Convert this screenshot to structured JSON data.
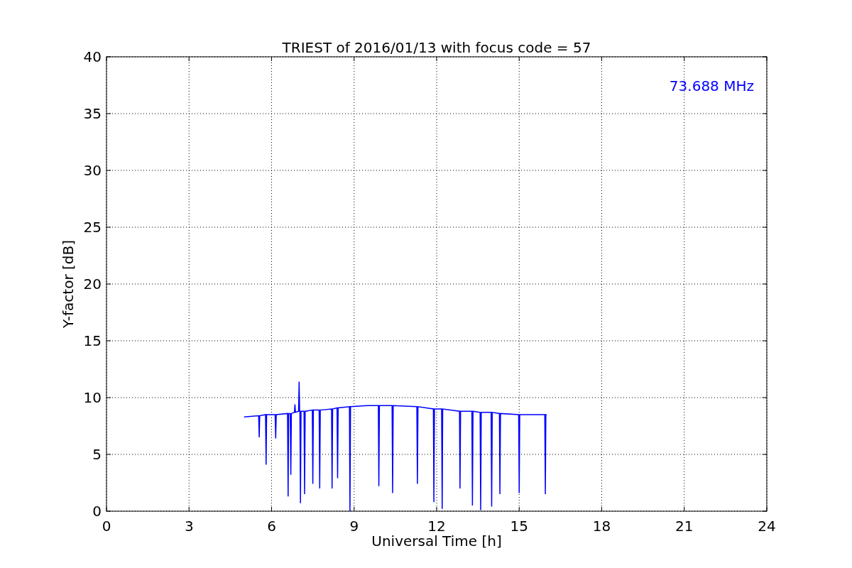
{
  "chart_data": {
    "type": "line",
    "title": "TRIEST of 2016/01/13 with focus code = 57",
    "xlabel": "Universal Time [h]",
    "ylabel": "Y-factor [dB]",
    "xlim": [
      0,
      24
    ],
    "ylim": [
      0,
      40
    ],
    "grid": true,
    "xticks": [
      0,
      3,
      6,
      9,
      12,
      15,
      18,
      21,
      24
    ],
    "yticks": [
      0,
      5,
      10,
      15,
      20,
      25,
      30,
      35,
      40
    ],
    "series": [
      {
        "name": "73.688 MHz",
        "color": "#0000ff",
        "x": [
          5.0,
          5.53,
          5.55,
          5.57,
          5.78,
          5.8,
          5.82,
          6.13,
          6.15,
          6.17,
          6.58,
          6.6,
          6.62,
          6.68,
          6.7,
          6.72,
          6.83,
          6.85,
          6.87,
          6.98,
          7.0,
          7.02,
          7.03,
          7.05,
          7.07,
          7.18,
          7.2,
          7.22,
          7.48,
          7.5,
          7.52,
          7.73,
          7.75,
          7.77,
          8.18,
          8.2,
          8.22,
          8.38,
          8.4,
          8.42,
          8.83,
          8.85,
          8.87,
          9.5,
          9.88,
          9.9,
          9.92,
          10.38,
          10.4,
          10.42,
          11.28,
          11.3,
          11.32,
          11.88,
          11.9,
          11.92,
          12.18,
          12.2,
          12.22,
          12.83,
          12.85,
          12.87,
          13.28,
          13.3,
          13.32,
          13.58,
          13.6,
          13.62,
          13.98,
          14.0,
          14.02,
          14.28,
          14.3,
          14.32,
          14.98,
          15.0,
          15.02,
          15.93,
          15.95,
          15.97,
          16.0
        ],
        "values": [
          8.3,
          8.4,
          6.5,
          8.4,
          8.5,
          4.1,
          8.5,
          8.5,
          6.4,
          8.5,
          8.6,
          1.3,
          8.6,
          8.6,
          3.2,
          8.6,
          8.7,
          9.4,
          8.7,
          8.8,
          11.4,
          8.8,
          8.8,
          0.7,
          8.8,
          8.8,
          1.5,
          8.8,
          8.9,
          2.4,
          8.9,
          8.9,
          2.0,
          8.9,
          9.0,
          2.0,
          9.0,
          9.1,
          2.9,
          9.1,
          9.2,
          0.0,
          9.2,
          9.3,
          9.3,
          2.2,
          9.3,
          9.3,
          1.6,
          9.3,
          9.2,
          2.4,
          9.2,
          9.0,
          0.8,
          9.0,
          9.0,
          0.2,
          9.0,
          8.8,
          2.0,
          8.8,
          8.8,
          0.5,
          8.8,
          8.7,
          0.1,
          8.7,
          8.7,
          0.4,
          8.7,
          8.6,
          1.5,
          8.6,
          8.5,
          1.6,
          8.5,
          8.5,
          1.5,
          8.5,
          8.5
        ]
      }
    ]
  }
}
